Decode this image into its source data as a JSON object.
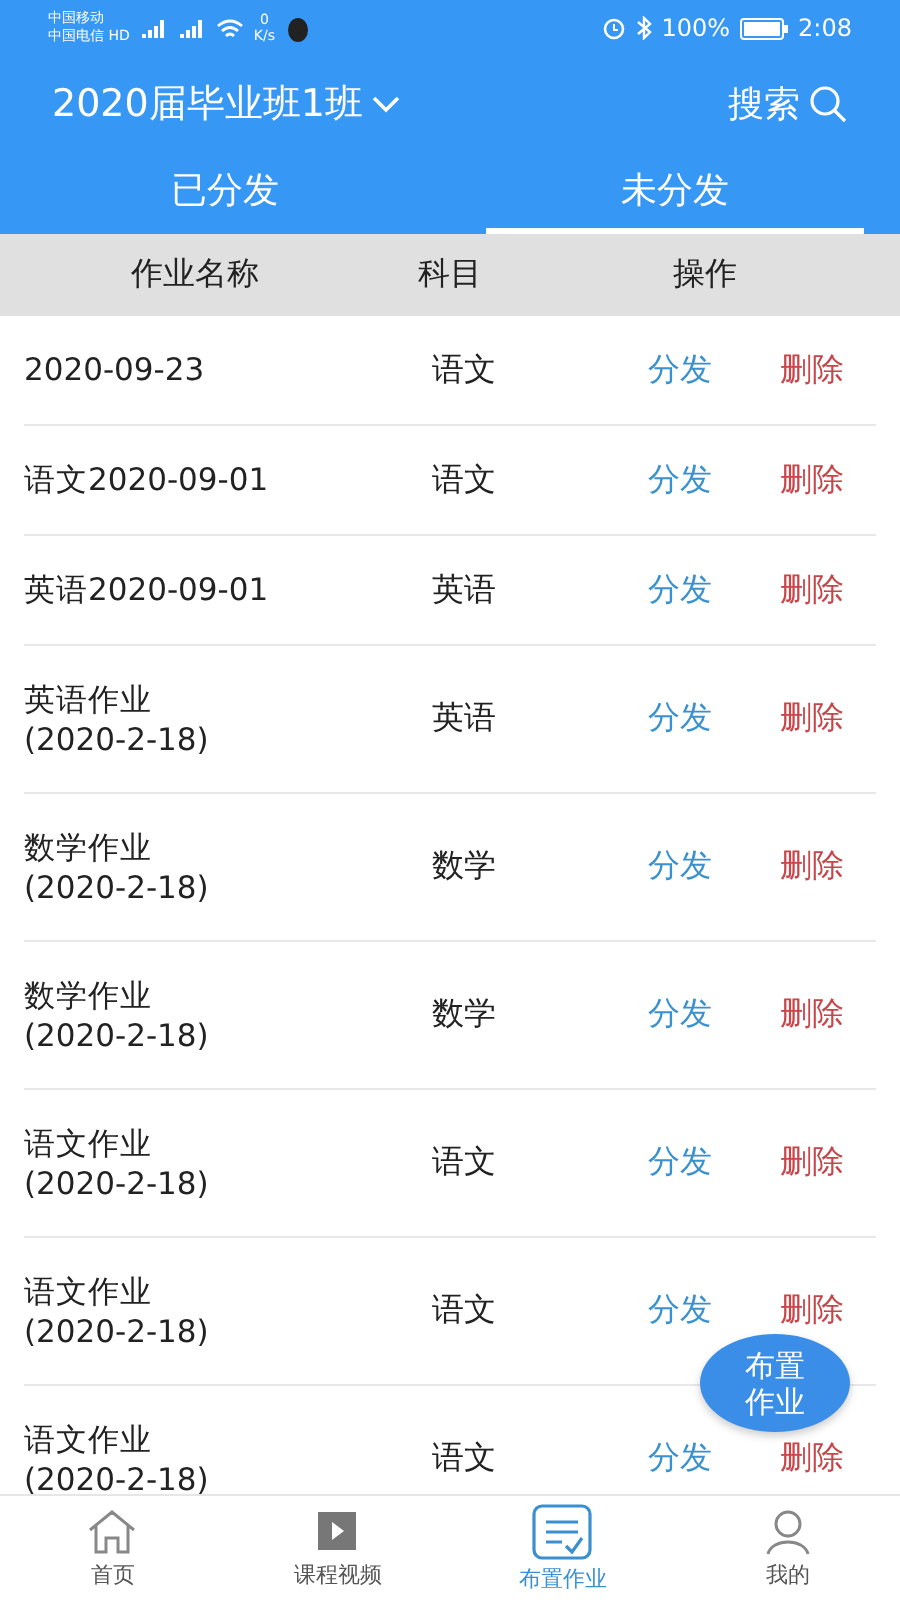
{
  "status_bar": {
    "carrier_1": "中国移动",
    "carrier_2": "中国电信",
    "hd": "HD",
    "speed_value": "0",
    "speed_unit": "K/s",
    "battery": "100%",
    "time": "2:08"
  },
  "header": {
    "class_name": "2020届毕业班1班",
    "search": "搜索"
  },
  "tabs": [
    {
      "label": "已分发",
      "selected": false
    },
    {
      "label": "未分发",
      "selected": true
    }
  ],
  "table": {
    "columns": [
      "作业名称",
      "科目",
      "操作"
    ],
    "rows": [
      {
        "name": "2020-09-23",
        "subject": "语文",
        "distribute": "分发",
        "delete": "删除"
      },
      {
        "name": "语文2020-09-01",
        "subject": "语文",
        "distribute": "分发",
        "delete": "删除"
      },
      {
        "name": "英语2020-09-01",
        "subject": "英语",
        "distribute": "分发",
        "delete": "删除"
      },
      {
        "name": "英语作业\n(2020-2-18)",
        "subject": "英语",
        "distribute": "分发",
        "delete": "删除"
      },
      {
        "name": "数学作业\n(2020-2-18)",
        "subject": "数学",
        "distribute": "分发",
        "delete": "删除"
      },
      {
        "name": "数学作业\n(2020-2-18)",
        "subject": "数学",
        "distribute": "分发",
        "delete": "删除"
      },
      {
        "name": "语文作业\n(2020-2-18)",
        "subject": "语文",
        "distribute": "分发",
        "delete": "删除"
      },
      {
        "name": "语文作业\n(2020-2-18)",
        "subject": "语文",
        "distribute": "分发",
        "delete": "删除"
      },
      {
        "name": "语文作业\n(2020-2-18)",
        "subject": "语文",
        "distribute": "分发",
        "delete": "删除"
      }
    ]
  },
  "fab": [
    "布置",
    "作业"
  ],
  "bottom_nav": [
    {
      "kind": "home",
      "label": "首页",
      "selected": false
    },
    {
      "kind": "video",
      "label": "课程视频",
      "selected": false
    },
    {
      "kind": "assign",
      "label": "布置作业",
      "selected": true
    },
    {
      "kind": "me",
      "label": "我的",
      "selected": false
    }
  ]
}
